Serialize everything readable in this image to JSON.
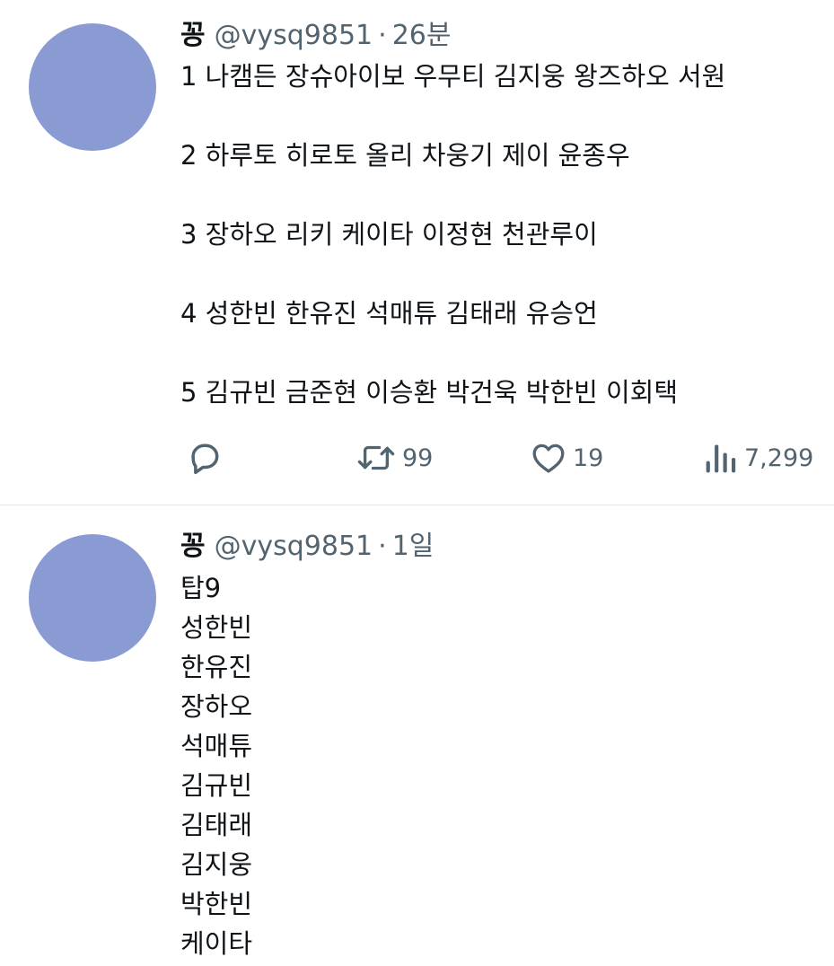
{
  "tweets": [
    {
      "author": {
        "display_name": "꽁",
        "handle": "@vysq9851",
        "avatar_color": "#8a9bd4"
      },
      "separator": "·",
      "time": "26분",
      "lines": [
        "1 나캠든 장슈아이보 우무티 김지웅 왕즈하오 서원",
        "2 하루토 히로토 올리 차웅기 제이 윤종우",
        "3 장하오 리키 케이타 이정현 천관루이",
        "4 성한빈 한유진 석매튜 김태래 유승언",
        "5 김규빈 금준현 이승환 박건욱 박한빈 이회택"
      ],
      "actions": {
        "reply": {
          "icon": "reply-icon",
          "count": ""
        },
        "retweet": {
          "icon": "retweet-icon",
          "count": "99"
        },
        "like": {
          "icon": "heart-icon",
          "count": "19"
        },
        "views": {
          "icon": "views-icon",
          "count": "7,299"
        }
      }
    },
    {
      "author": {
        "display_name": "꽁",
        "handle": "@vysq9851",
        "avatar_color": "#8a9bd4"
      },
      "separator": "·",
      "time": "1일",
      "lines": [
        "탑9",
        "성한빈",
        "한유진",
        "장하오",
        "석매튜",
        "김규빈",
        "김태래",
        "김지웅",
        "박한빈",
        "케이타"
      ]
    }
  ],
  "colors": {
    "text_primary": "#0f1419",
    "text_secondary": "#536471",
    "divider": "#e6e9eb",
    "background": "#ffffff"
  }
}
